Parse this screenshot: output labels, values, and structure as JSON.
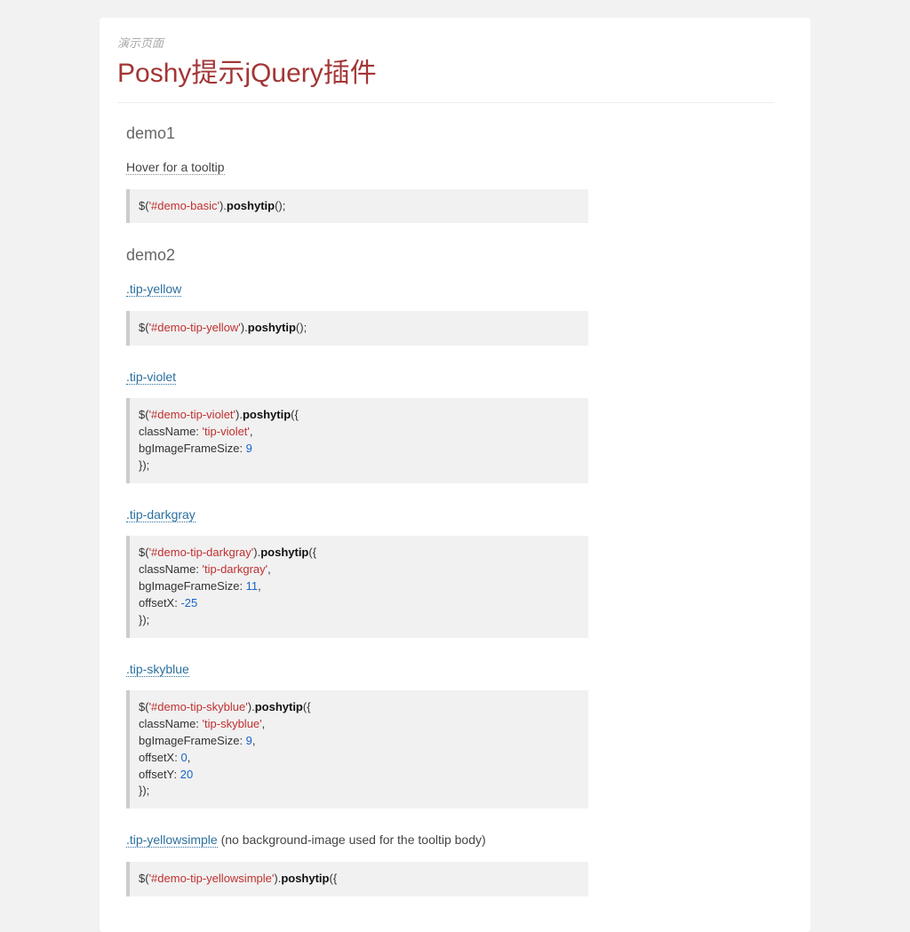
{
  "header": {
    "subtitle": "演示页面",
    "title": "Poshy提示jQuery插件"
  },
  "demo1": {
    "heading": "demo1",
    "trigger": "Hover for a tooltip",
    "code": {
      "selector": "'#demo-basic'",
      "fn": "poshytip"
    }
  },
  "demo2": {
    "heading": "demo2",
    "items": {
      "yellow": {
        "label": ".tip-yellow",
        "selector": "'#demo-tip-yellow'",
        "fn": "poshytip"
      },
      "violet": {
        "label": ".tip-violet",
        "selector": "'#demo-tip-violet'",
        "fn": "poshytip",
        "className": "'tip-violet'",
        "bgImageFrameSize": "9"
      },
      "darkgray": {
        "label": ".tip-darkgray",
        "selector": "'#demo-tip-darkgray'",
        "fn": "poshytip",
        "className": "'tip-darkgray'",
        "bgImageFrameSize": "11",
        "offsetX": "-25"
      },
      "skyblue": {
        "label": ".tip-skyblue",
        "selector": "'#demo-tip-skyblue'",
        "fn": "poshytip",
        "className": "'tip-skyblue'",
        "bgImageFrameSize": "9",
        "offsetX": "0",
        "offsetY": "20"
      },
      "yellowsimple": {
        "label": ".tip-yellowsimple",
        "note": " (no background-image used for the tooltip body)",
        "selector": "'#demo-tip-yellowsimple'",
        "fn": "poshytip"
      }
    }
  }
}
